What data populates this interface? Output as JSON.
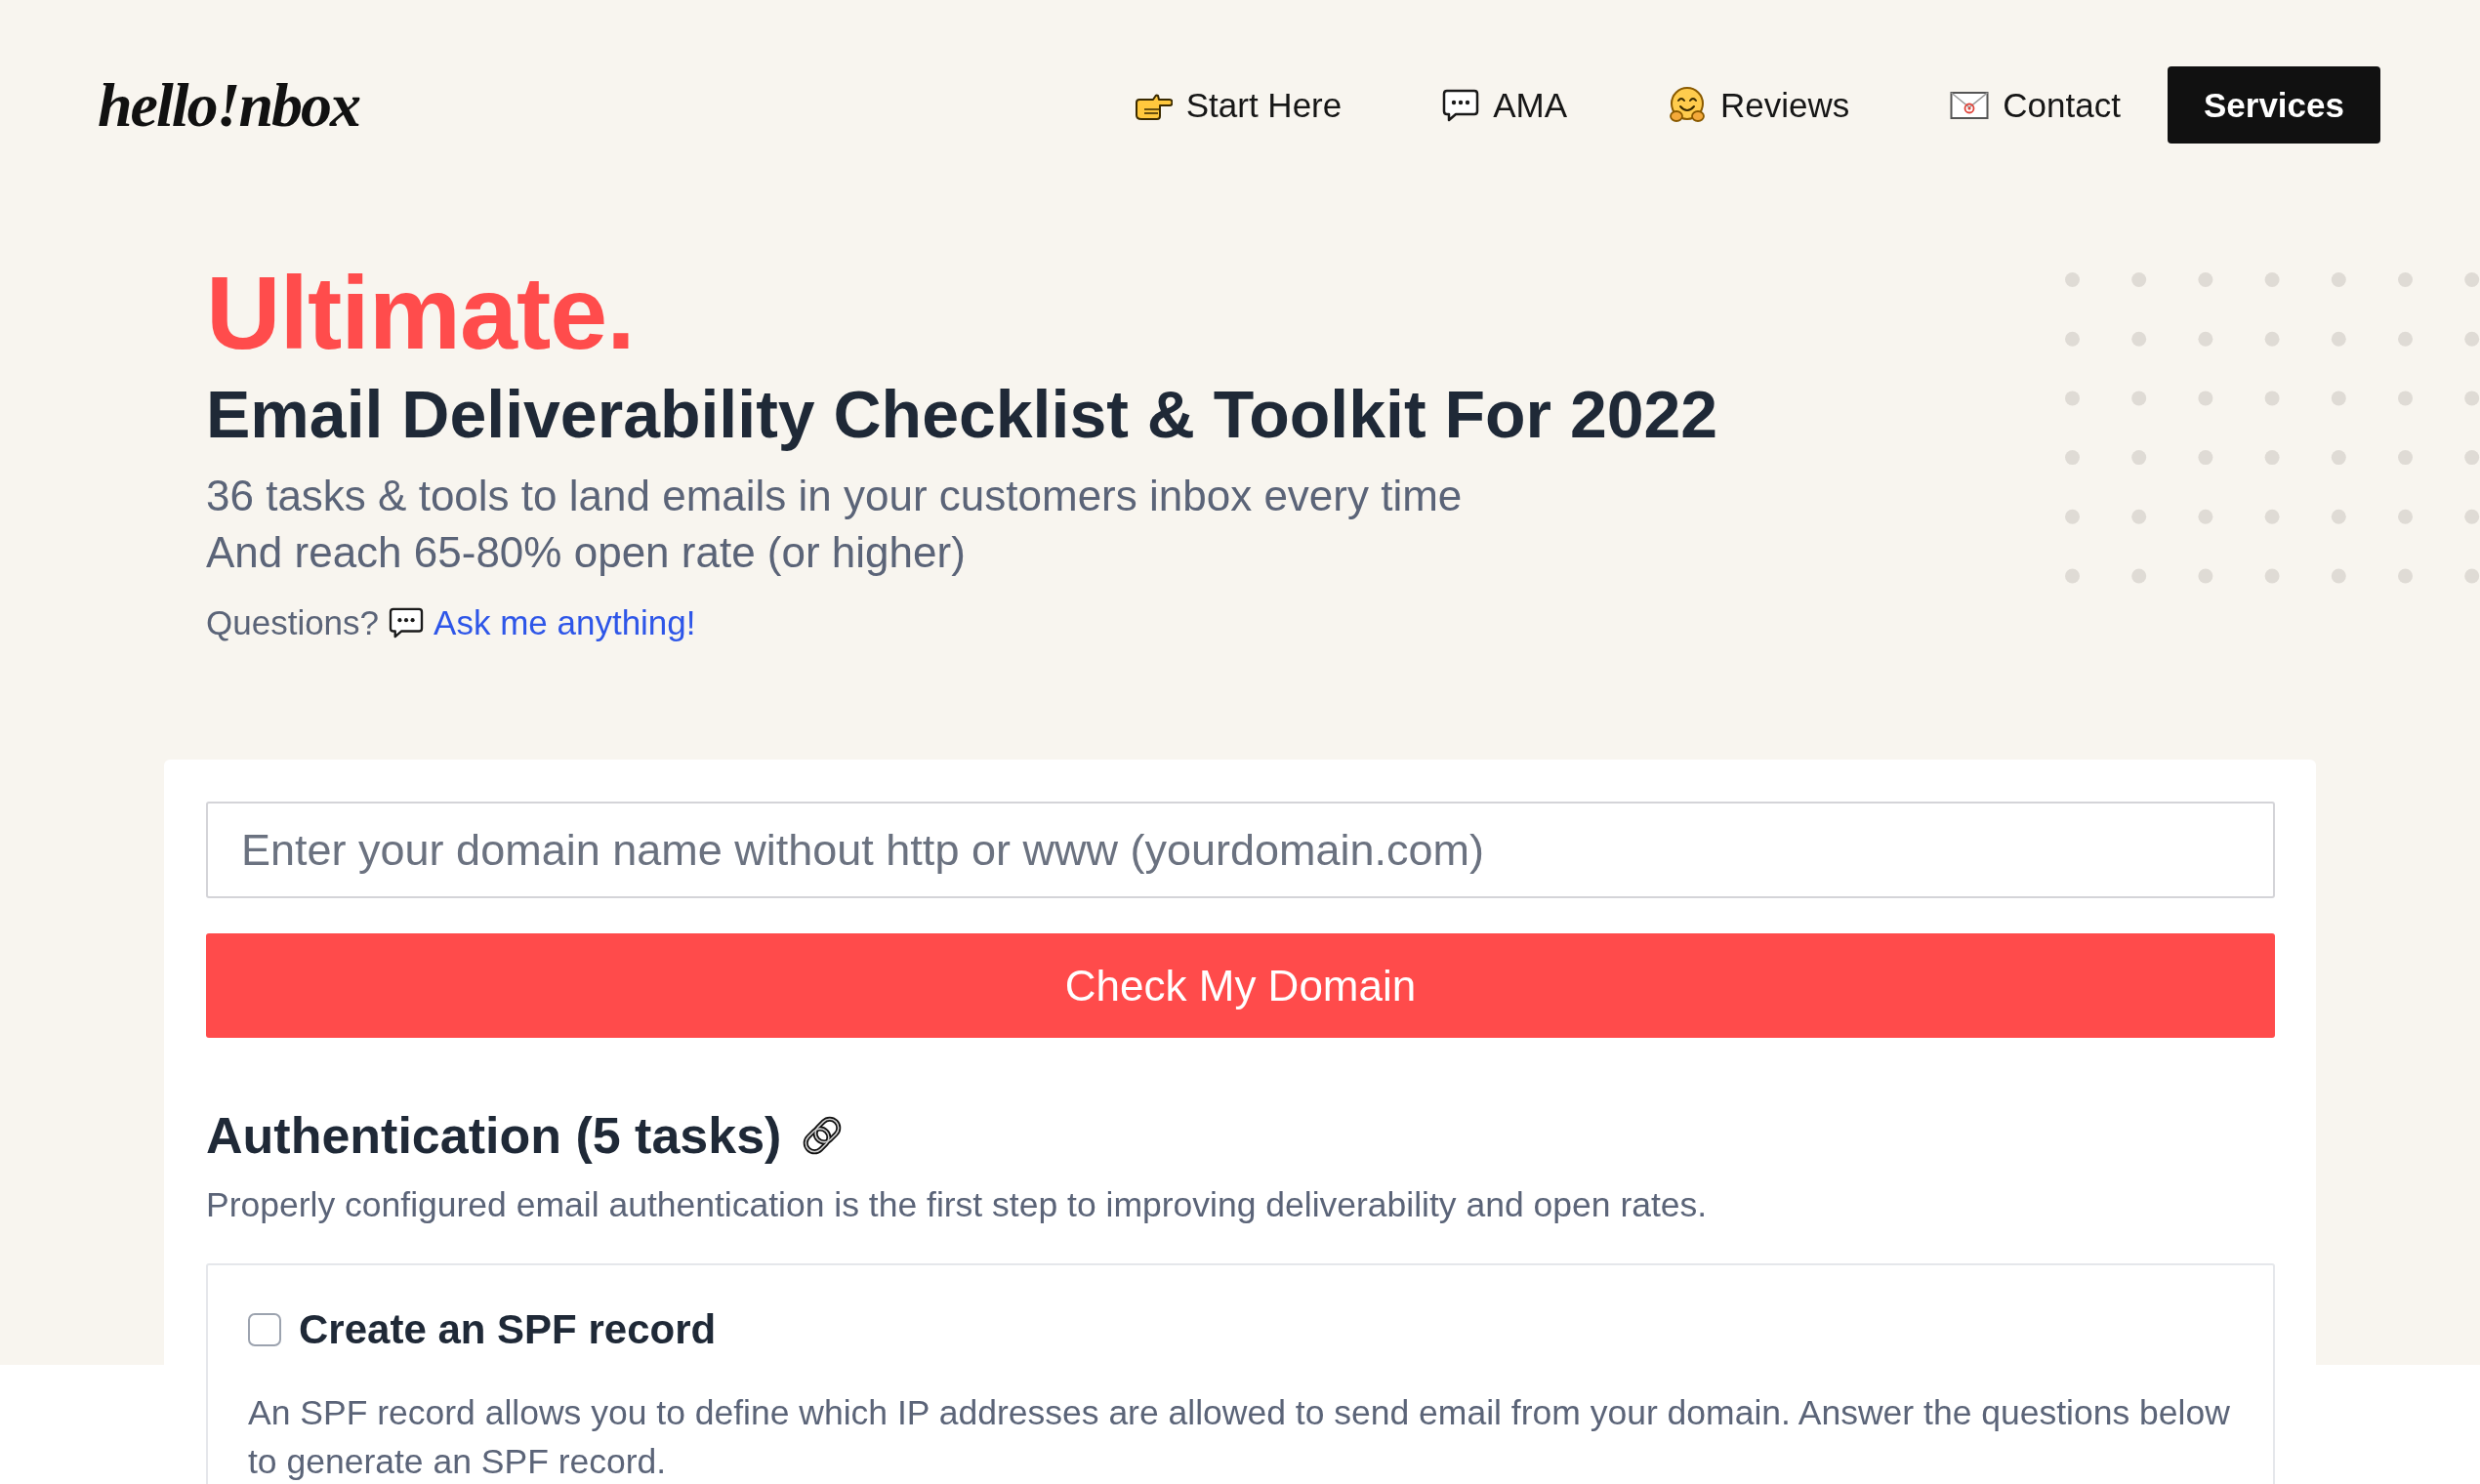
{
  "header": {
    "logo": "hello!nbox",
    "nav": [
      {
        "label": "Start Here"
      },
      {
        "label": "AMA"
      },
      {
        "label": "Reviews"
      },
      {
        "label": "Contact"
      }
    ],
    "button": "Services"
  },
  "hero": {
    "title": "Ultimate.",
    "heading": "Email Deliverability Checklist & Toolkit For 2022",
    "lines": [
      "36 tasks & tools to land emails in your customers inbox every time",
      "And reach 65-80% open rate (or higher)"
    ],
    "question": "Questions?",
    "link": "Ask me anything!"
  },
  "checker": {
    "domain_field": {
      "placeholder": "Enter your domain name without http or www (yourdomain.com)"
    },
    "button": "Check My Domain"
  },
  "sections": [
    {
      "title": "Authentication (5 tasks)",
      "description": "Properly configured email authentication is the first step to improving deliverability and open rates.",
      "tasks": [
        {
          "title": "Create an SPF record",
          "checked": false,
          "description": "An SPF record allows you to define which IP addresses are allowed to send email from your domain. Answer the questions below to generate an SPF record."
        }
      ]
    }
  ]
}
